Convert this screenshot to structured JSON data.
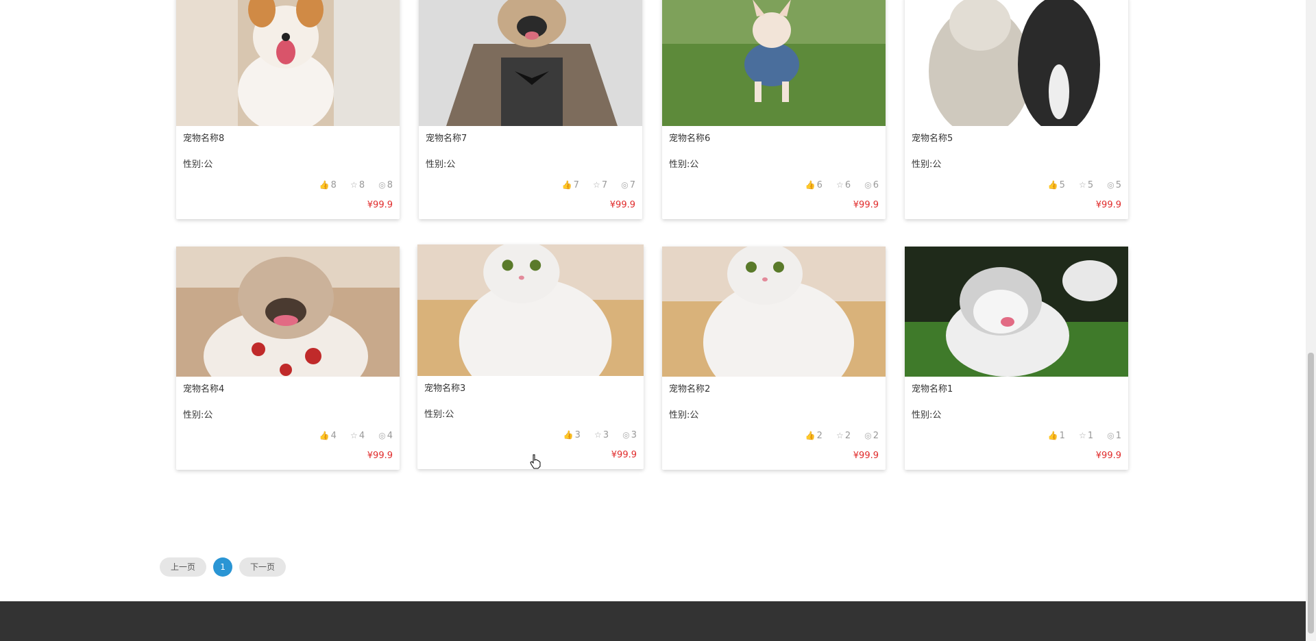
{
  "pets": [
    {
      "name": "宠物名称8",
      "gender": "性别:公",
      "likes": "8",
      "favorites": "8",
      "views": "8",
      "price": "¥99.9"
    },
    {
      "name": "宠物名称7",
      "gender": "性别:公",
      "likes": "7",
      "favorites": "7",
      "views": "7",
      "price": "¥99.9"
    },
    {
      "name": "宠物名称6",
      "gender": "性别:公",
      "likes": "6",
      "favorites": "6",
      "views": "6",
      "price": "¥99.9"
    },
    {
      "name": "宠物名称5",
      "gender": "性别:公",
      "likes": "5",
      "favorites": "5",
      "views": "5",
      "price": "¥99.9"
    },
    {
      "name": "宠物名称4",
      "gender": "性别:公",
      "likes": "4",
      "favorites": "4",
      "views": "4",
      "price": "¥99.9"
    },
    {
      "name": "宠物名称3",
      "gender": "性别:公",
      "likes": "3",
      "favorites": "3",
      "views": "3",
      "price": "¥99.9"
    },
    {
      "name": "宠物名称2",
      "gender": "性别:公",
      "likes": "2",
      "favorites": "2",
      "views": "2",
      "price": "¥99.9"
    },
    {
      "name": "宠物名称1",
      "gender": "性别:公",
      "likes": "1",
      "favorites": "1",
      "views": "1",
      "price": "¥99.9"
    }
  ],
  "pagination": {
    "prev_label": "上一页",
    "current_page": "1",
    "next_label": "下一页"
  },
  "icons": {
    "like": "thumbs-up-icon",
    "favorite": "star-icon",
    "view": "eye-icon"
  },
  "colors": {
    "price": "#e02a2a",
    "page_active": "#2a95d4",
    "footer": "#333333"
  }
}
